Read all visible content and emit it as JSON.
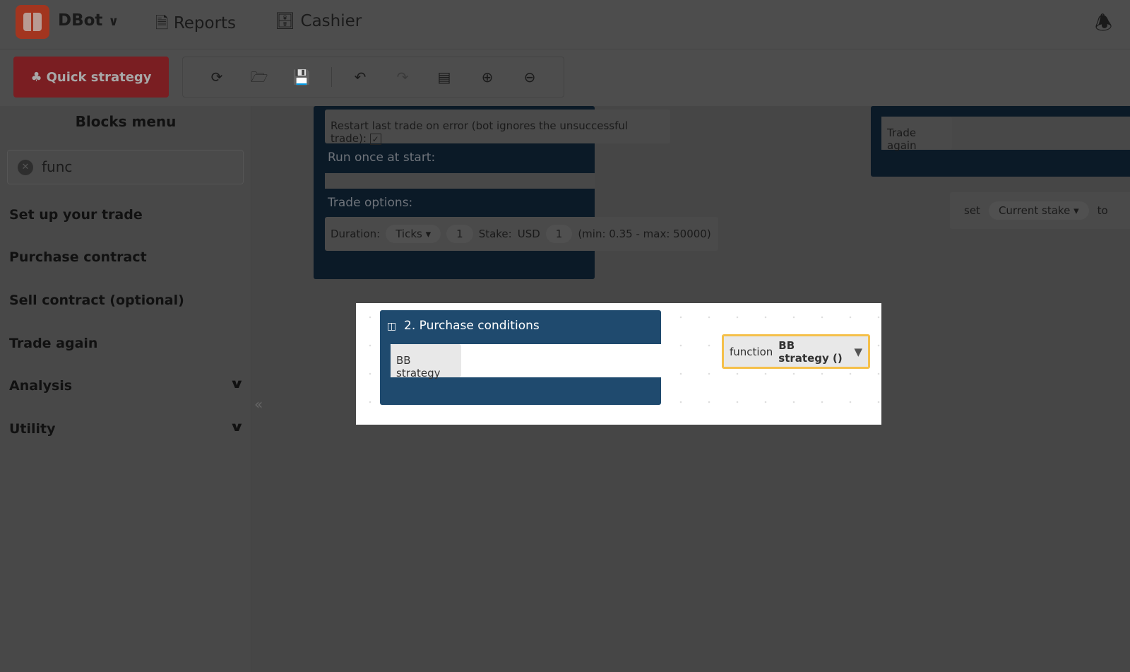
{
  "header": {
    "app_name": "DBot",
    "nav": [
      "Reports",
      "Cashier"
    ]
  },
  "toolbar": {
    "quick_strategy": "Quick strategy",
    "icons": [
      "reset-icon",
      "open-icon",
      "save-icon",
      "undo-icon",
      "redo-icon",
      "sort-icon",
      "zoom-in-icon",
      "zoom-out-icon"
    ]
  },
  "sidebar": {
    "title": "Blocks menu",
    "search_value": "func",
    "items": [
      {
        "label": "Set up your trade"
      },
      {
        "label": "Purchase contract"
      },
      {
        "label": "Sell contract (optional)"
      },
      {
        "label": "Trade again"
      },
      {
        "label": "Analysis"
      },
      {
        "label": "Utility"
      }
    ]
  },
  "workspace": {
    "restart_label": "Restart last trade on error (bot ignores the unsuccessful trade):",
    "restart_checked": true,
    "run_once": "Run once at start:",
    "trade_options": "Trade options:",
    "duration_label": "Duration:",
    "duration_unit": "Ticks",
    "duration_value": "1",
    "stake_label": "Stake:",
    "currency": "USD",
    "stake_value": "1",
    "stake_range": "(min: 0.35 - max: 50000)",
    "trade_again": "Trade again",
    "set_label": "set",
    "set_var": "Current stake",
    "to_label": "to"
  },
  "highlight": {
    "block_title": "2. Purchase conditions",
    "inner_block": "BB strategy",
    "function_label": "function",
    "function_name": "BB strategy ()"
  },
  "colors": {
    "accent": "#ff444f",
    "block": "#0e4474",
    "highlight_border": "#f5c04a"
  }
}
